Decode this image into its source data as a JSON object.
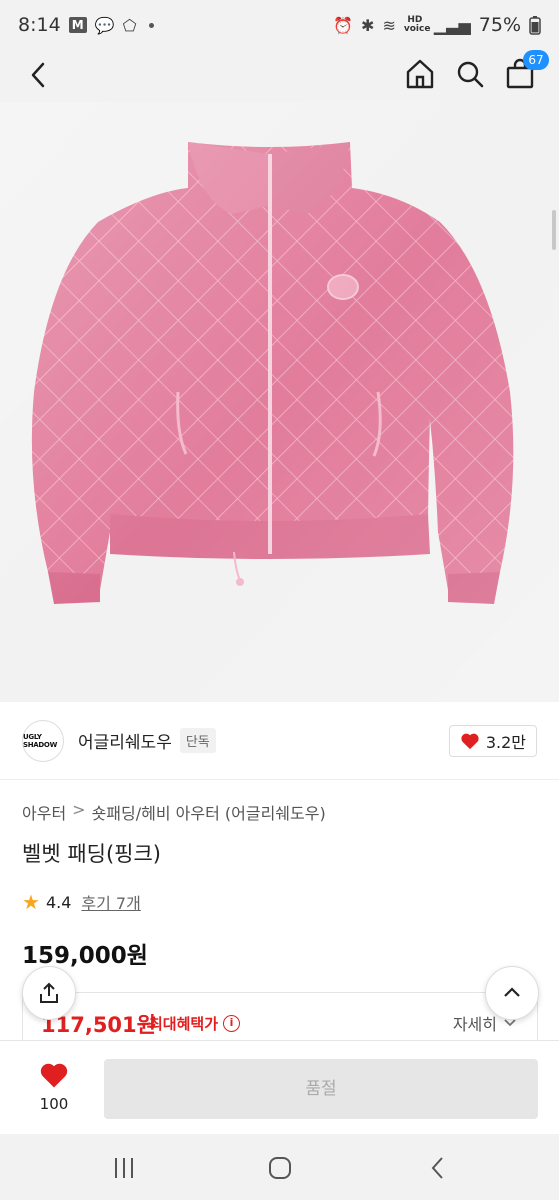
{
  "status_bar": {
    "time": "8:14",
    "mail_badge": "M",
    "network": "HD voice",
    "battery": "75%"
  },
  "nav": {
    "cart_count": "67"
  },
  "brand": {
    "logo_text": "UGLY SHADOW",
    "name": "어글리쉐도우",
    "tag": "단독",
    "likes": "3.2만"
  },
  "breadcrumb": {
    "level1": "아우터",
    "separator": ">",
    "level2": "숏패딩/헤비 아우터 (어글리쉐도우)"
  },
  "product": {
    "title": "벨벳 패딩(핑크)",
    "rating": "4.4",
    "reviews": "후기 7개",
    "price": "159,000원",
    "benefit_price": "117,501원",
    "benefit_label": "최대혜택가",
    "benefit_detail": "자세히"
  },
  "bottom": {
    "wish_count": "100",
    "soldout_label": "품절"
  },
  "colors": {
    "accent_red": "#e02020",
    "cart_badge": "#1e90ff",
    "jacket_pink": "#e57f9e"
  }
}
